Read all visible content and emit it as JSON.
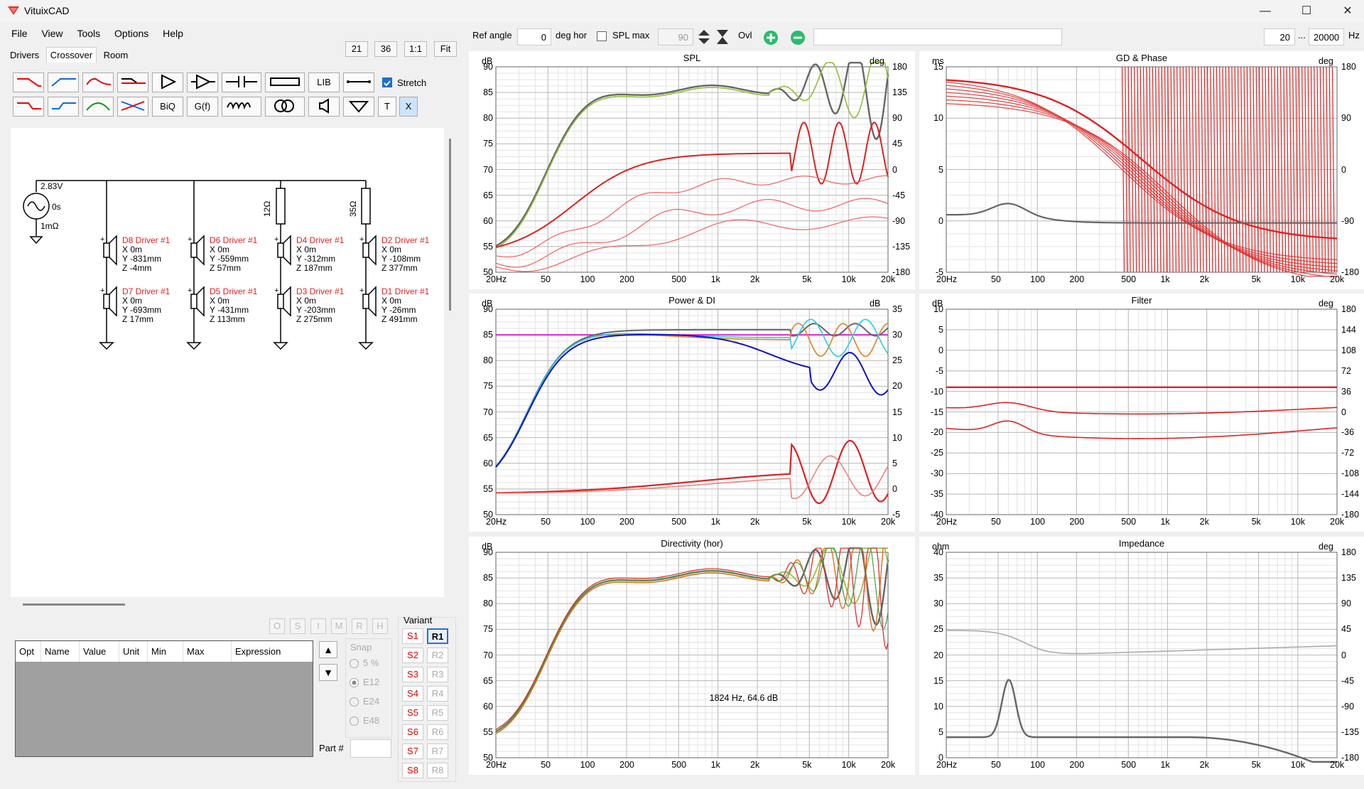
{
  "app": {
    "title": "VituixCAD"
  },
  "window": {
    "minimize": "—",
    "maximize": "☐",
    "close": "✕"
  },
  "menu": [
    "File",
    "View",
    "Tools",
    "Options",
    "Help"
  ],
  "tabs": [
    "Drivers",
    "Crossover",
    "Room"
  ],
  "zoom_buttons": [
    "21",
    "36",
    "1:1",
    "Fit"
  ],
  "toolbar": {
    "lib": "LIB",
    "biq": "BiQ",
    "gf": "G(f)",
    "t": "T",
    "x": "X",
    "stretch_label": "Stretch",
    "stretch_checked": true
  },
  "schematic": {
    "source": {
      "voltage": "2.83V",
      "delay": "0s",
      "resistance": "1mΩ"
    },
    "resistors": [
      "12Ω",
      "35Ω"
    ],
    "drivers": [
      {
        "name": "D8 Driver #1",
        "x": "X 0m",
        "y": "Y -831mm",
        "z": "Z -4mm"
      },
      {
        "name": "D6 Driver #1",
        "x": "X 0m",
        "y": "Y -559mm",
        "z": "Z 57mm"
      },
      {
        "name": "D4 Driver #1",
        "x": "X 0m",
        "y": "Y -312mm",
        "z": "Z 187mm"
      },
      {
        "name": "D2 Driver #1",
        "x": "X 0m",
        "y": "Y -108mm",
        "z": "Z 377mm"
      },
      {
        "name": "D7 Driver #1",
        "x": "X 0m",
        "y": "Y -693mm",
        "z": "Z 17mm"
      },
      {
        "name": "D5 Driver #1",
        "x": "X 0m",
        "y": "Y -431mm",
        "z": "Z 113mm"
      },
      {
        "name": "D3 Driver #1",
        "x": "X 0m",
        "y": "Y -203mm",
        "z": "Z 275mm"
      },
      {
        "name": "D1 Driver #1",
        "x": "X 0m",
        "y": "Y -26mm",
        "z": "Z 491mm"
      }
    ]
  },
  "ohbuttons": [
    "O",
    "S",
    "I",
    "M",
    "R",
    "H"
  ],
  "params_table": {
    "columns": [
      "Opt",
      "Name",
      "Value",
      "Unit",
      "Min",
      "Max",
      "Expression"
    ]
  },
  "snap": {
    "label": "Snap",
    "options": [
      "5 %",
      "E12",
      "E24",
      "E48"
    ],
    "selected": "E12"
  },
  "part_label": "Part #",
  "variant": {
    "label": "Variant",
    "s": [
      "S1",
      "S2",
      "S3",
      "S4",
      "S5",
      "S6",
      "S7",
      "S8"
    ],
    "r": [
      "R1",
      "R2",
      "R3",
      "R4",
      "R5",
      "R6",
      "R7",
      "R8"
    ],
    "selected": "R1"
  },
  "plotbar": {
    "ref_angle_label": "Ref angle",
    "ref_angle": "0",
    "deg_hor": "deg hor",
    "spl_max_label": "SPL max",
    "spl_max_value": "90",
    "ovl": "Ovl",
    "f_min": "20",
    "dots": "...",
    "f_max": "20000",
    "hz": "Hz"
  },
  "freq_ticks": [
    "20Hz",
    "50",
    "100",
    "200",
    "500",
    "1k",
    "2k",
    "5k",
    "10k",
    "20k"
  ],
  "panels": {
    "spl": {
      "title": "SPL",
      "left_unit": "dB",
      "right_unit": "deg",
      "left_ticks": [
        "90",
        "85",
        "80",
        "75",
        "70",
        "65",
        "60",
        "55",
        "50"
      ],
      "right_ticks": [
        "180",
        "135",
        "90",
        "45",
        "0",
        "-45",
        "-90",
        "-135",
        "-180"
      ]
    },
    "gd": {
      "title": "GD & Phase",
      "left_unit": "ms",
      "right_unit": "deg",
      "left_ticks": [
        "15",
        "10",
        "5",
        "0",
        "-5"
      ],
      "right_ticks": [
        "180",
        "90",
        "0",
        "-90",
        "-180"
      ]
    },
    "power": {
      "title": "Power & DI",
      "left_unit": "dB",
      "right_unit": "dB",
      "left_ticks": [
        "90",
        "85",
        "80",
        "75",
        "70",
        "65",
        "60",
        "55",
        "50"
      ],
      "right_ticks": [
        "35",
        "30",
        "25",
        "20",
        "15",
        "10",
        "5",
        "0",
        "-5"
      ]
    },
    "filter": {
      "title": "Filter",
      "left_unit": "dB",
      "right_unit": "deg",
      "left_ticks": [
        "10",
        "5",
        "0",
        "-5",
        "-10",
        "-15",
        "-20",
        "-25",
        "-30",
        "-35",
        "-40"
      ],
      "right_ticks": [
        "180",
        "144",
        "108",
        "72",
        "36",
        "0",
        "-36",
        "-72",
        "-108",
        "-144",
        "-180"
      ]
    },
    "directivity": {
      "title": "Directivity (hor)",
      "left_unit": "dB",
      "annotation": "1824 Hz, 64.6 dB",
      "left_ticks": [
        "90",
        "85",
        "80",
        "75",
        "70",
        "65",
        "60",
        "55",
        "50"
      ]
    },
    "impedance": {
      "title": "Impedance",
      "left_unit": "ohm",
      "right_unit": "deg",
      "left_ticks": [
        "40",
        "35",
        "30",
        "25",
        "20",
        "15",
        "10",
        "5",
        "0"
      ],
      "right_ticks": [
        "180",
        "135",
        "90",
        "45",
        "0",
        "-45",
        "-90",
        "-135",
        "-180"
      ]
    }
  }
}
